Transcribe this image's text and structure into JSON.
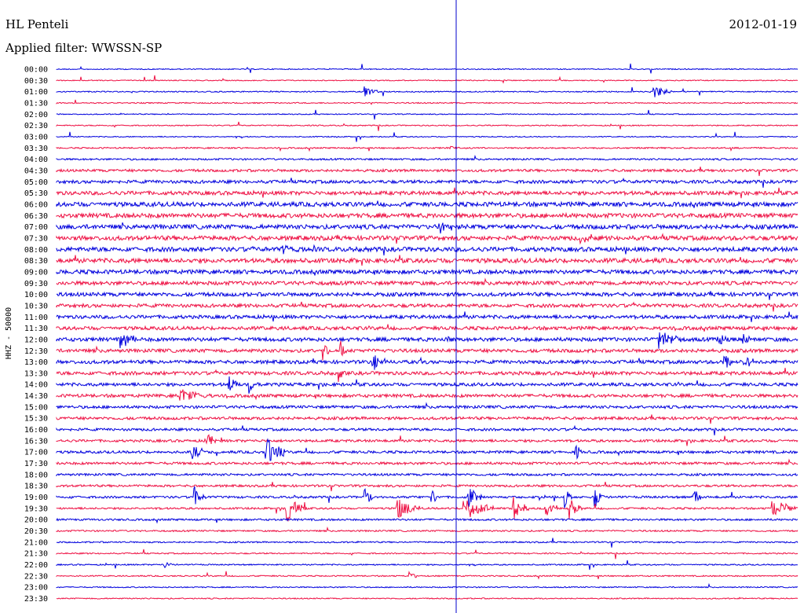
{
  "header": {
    "station": "HL Penteli",
    "date": "2012-01-19",
    "filter": "Applied filter: WWSSN-SP"
  },
  "chart_data": {
    "type": "line",
    "title": "HL Penteli",
    "date": "2012-01-19",
    "filter_note": "Applied filter: WWSSN-SP",
    "ylabel": "HHZ - 50000",
    "xlabel": "",
    "row_labels": [
      "00:00",
      "00:30",
      "01:00",
      "01:30",
      "02:00",
      "02:30",
      "03:00",
      "03:30",
      "04:00",
      "04:30",
      "05:00",
      "05:30",
      "06:00",
      "06:30",
      "07:00",
      "07:30",
      "08:00",
      "08:30",
      "09:00",
      "09:30",
      "10:00",
      "10:30",
      "11:00",
      "11:30",
      "12:00",
      "12:30",
      "13:00",
      "13:30",
      "14:00",
      "14:30",
      "15:00",
      "15:30",
      "16:00",
      "16:30",
      "17:00",
      "17:30",
      "18:00",
      "18:30",
      "19:00",
      "19:30",
      "20:00",
      "20:30",
      "21:00",
      "21:30",
      "22:00",
      "22:30",
      "23:00",
      "23:30"
    ],
    "trace_colors": [
      "#0000dd",
      "#ee1144"
    ],
    "marker_line_color": "#0000cc",
    "noise_levels": [
      0.6,
      0.6,
      0.7,
      0.7,
      0.6,
      0.7,
      0.6,
      0.9,
      1.1,
      1.6,
      2.0,
      2.4,
      2.8,
      2.8,
      2.8,
      2.8,
      2.8,
      2.8,
      2.6,
      2.4,
      2.4,
      2.2,
      2.2,
      2.2,
      2.4,
      2.2,
      2.2,
      2.2,
      2.0,
      2.0,
      1.8,
      1.8,
      1.6,
      1.6,
      1.6,
      1.6,
      1.4,
      1.4,
      1.4,
      1.2,
      1.2,
      1.0,
      0.9,
      0.8,
      0.8,
      0.8,
      0.7,
      0.7
    ],
    "events": [
      {
        "row": 2,
        "minute": 12.5,
        "amp": 7,
        "dur": 0.6
      },
      {
        "row": 2,
        "minute": 24.2,
        "amp": 9,
        "dur": 0.7
      },
      {
        "row": 7,
        "minute": 16.0,
        "amp": 3,
        "dur": 0.3
      },
      {
        "row": 14,
        "minute": 15.5,
        "amp": 8,
        "dur": 0.8
      },
      {
        "row": 15,
        "minute": 21.2,
        "amp": 9,
        "dur": 0.6
      },
      {
        "row": 16,
        "minute": 9.2,
        "amp": 6,
        "dur": 0.6
      },
      {
        "row": 24,
        "minute": 2.6,
        "amp": 10,
        "dur": 0.8
      },
      {
        "row": 24,
        "minute": 15.8,
        "amp": 6,
        "dur": 0.4
      },
      {
        "row": 24,
        "minute": 24.4,
        "amp": 12,
        "dur": 0.9
      },
      {
        "row": 24,
        "minute": 26.8,
        "amp": 10,
        "dur": 0.3
      },
      {
        "row": 24,
        "minute": 27.8,
        "amp": 10,
        "dur": 0.3
      },
      {
        "row": 25,
        "minute": 10.8,
        "amp": 14,
        "dur": 0.3
      },
      {
        "row": 25,
        "minute": 11.5,
        "amp": 12,
        "dur": 0.3
      },
      {
        "row": 26,
        "minute": 12.8,
        "amp": 14,
        "dur": 0.5
      },
      {
        "row": 26,
        "minute": 27.0,
        "amp": 14,
        "dur": 0.5
      },
      {
        "row": 26,
        "minute": 27.8,
        "amp": 14,
        "dur": 0.5
      },
      {
        "row": 27,
        "minute": 11.4,
        "amp": 12,
        "dur": 0.3
      },
      {
        "row": 28,
        "minute": 7.0,
        "amp": 12,
        "dur": 0.4
      },
      {
        "row": 28,
        "minute": 7.8,
        "amp": 12,
        "dur": 0.4
      },
      {
        "row": 29,
        "minute": 5.0,
        "amp": 8,
        "dur": 1.2
      },
      {
        "row": 34,
        "minute": 5.5,
        "amp": 14,
        "dur": 0.5
      },
      {
        "row": 34,
        "minute": 8.5,
        "amp": 18,
        "dur": 0.8
      },
      {
        "row": 33,
        "minute": 6.1,
        "amp": 10,
        "dur": 0.4
      },
      {
        "row": 34,
        "minute": 21.0,
        "amp": 12,
        "dur": 0.3
      },
      {
        "row": 38,
        "minute": 5.6,
        "amp": 14,
        "dur": 0.5
      },
      {
        "row": 38,
        "minute": 12.5,
        "amp": 14,
        "dur": 0.3
      },
      {
        "row": 38,
        "minute": 15.2,
        "amp": 14,
        "dur": 0.3
      },
      {
        "row": 38,
        "minute": 16.7,
        "amp": 14,
        "dur": 0.5
      },
      {
        "row": 38,
        "minute": 20.6,
        "amp": 14,
        "dur": 0.3
      },
      {
        "row": 38,
        "minute": 21.8,
        "amp": 14,
        "dur": 0.4
      },
      {
        "row": 38,
        "minute": 25.8,
        "amp": 14,
        "dur": 0.3
      },
      {
        "row": 39,
        "minute": 9.3,
        "amp": 18,
        "dur": 0.8
      },
      {
        "row": 39,
        "minute": 13.8,
        "amp": 14,
        "dur": 0.9
      },
      {
        "row": 39,
        "minute": 16.5,
        "amp": 16,
        "dur": 1.2
      },
      {
        "row": 39,
        "minute": 18.5,
        "amp": 16,
        "dur": 0.6
      },
      {
        "row": 39,
        "minute": 19.8,
        "amp": 14,
        "dur": 0.5
      },
      {
        "row": 39,
        "minute": 20.8,
        "amp": 14,
        "dur": 0.5
      },
      {
        "row": 39,
        "minute": 29.0,
        "amp": 12,
        "dur": 1.0
      },
      {
        "row": 44,
        "minute": 4.4,
        "amp": 5,
        "dur": 0.3
      },
      {
        "row": 45,
        "minute": 14.3,
        "amp": 6,
        "dur": 0.3
      }
    ]
  }
}
